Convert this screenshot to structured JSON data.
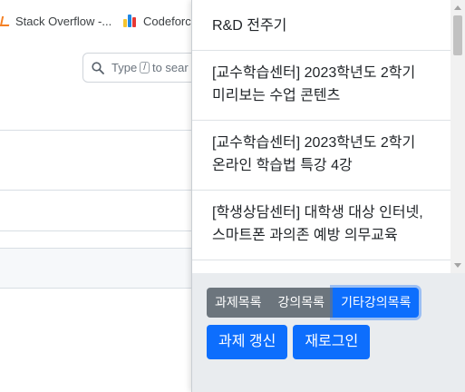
{
  "bookmarks": [
    {
      "label": "Stack Overflow -...",
      "icon": "stackoverflow-icon"
    },
    {
      "label": "Codeforce",
      "icon": "codeforces-icon"
    }
  ],
  "background_search": {
    "placeholder_before": "Type",
    "key": "/",
    "placeholder_after": "to sear"
  },
  "popup": {
    "items": [
      {
        "title": "R&D 전주기"
      },
      {
        "title": "[교수학습센터] 2023학년도 2학기 미리보는 수업 콘텐츠"
      },
      {
        "title": "[교수학습센터] 2023학년도 2학기 온라인 학습법 특강 4강"
      },
      {
        "title": "[학생상담센터] 대학생 대상 인터넷, 스마트폰 과의존 예방 의무교육"
      }
    ],
    "tabs": [
      {
        "label": "과제목록",
        "active": false
      },
      {
        "label": "강의목록",
        "active": false
      },
      {
        "label": "기타강의목록",
        "active": true
      }
    ],
    "refresh_label": "과제 갱신",
    "relogin_label": "재로그인"
  },
  "colors": {
    "primary": "#0d6efd",
    "secondary": "#6c757d",
    "footer_bg": "#e9ecef"
  }
}
